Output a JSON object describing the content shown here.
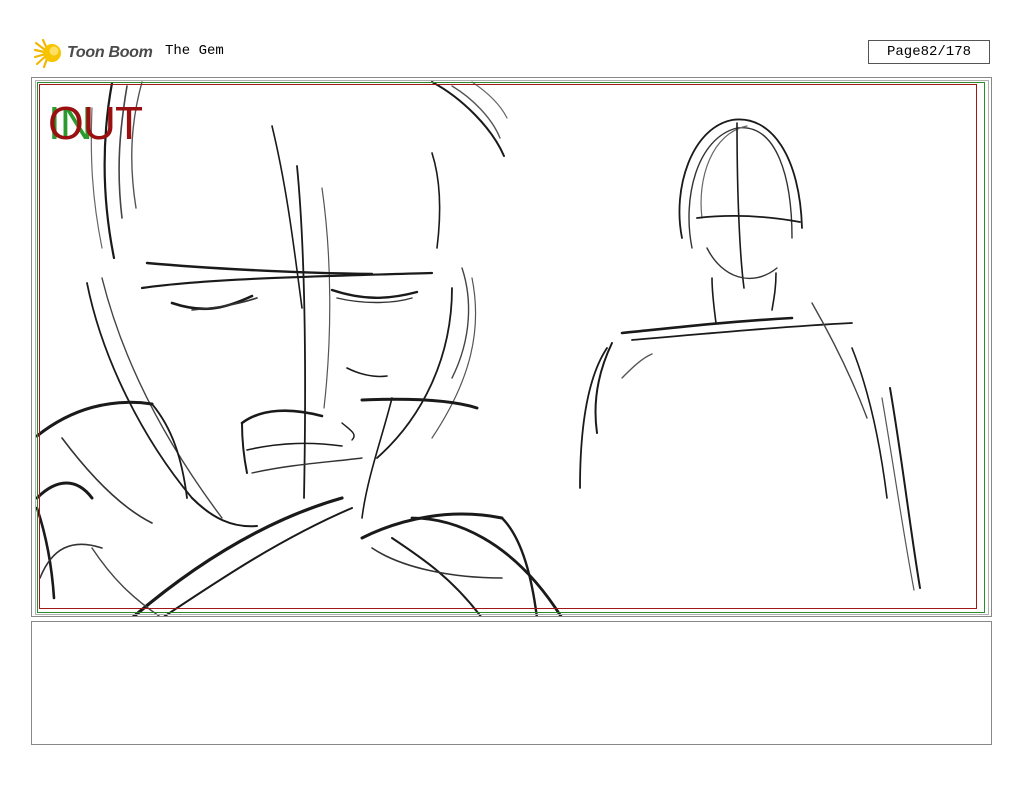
{
  "header": {
    "logo_text": "Toon Boom",
    "title": "The Gem",
    "page_label": "Page",
    "page_value": "82/178"
  },
  "panel": {
    "in_label": "IN",
    "out_label": "OUT",
    "frame_colors": {
      "out": "#a01818",
      "in": "#2d8a2d"
    }
  },
  "notes": {
    "text": ""
  }
}
